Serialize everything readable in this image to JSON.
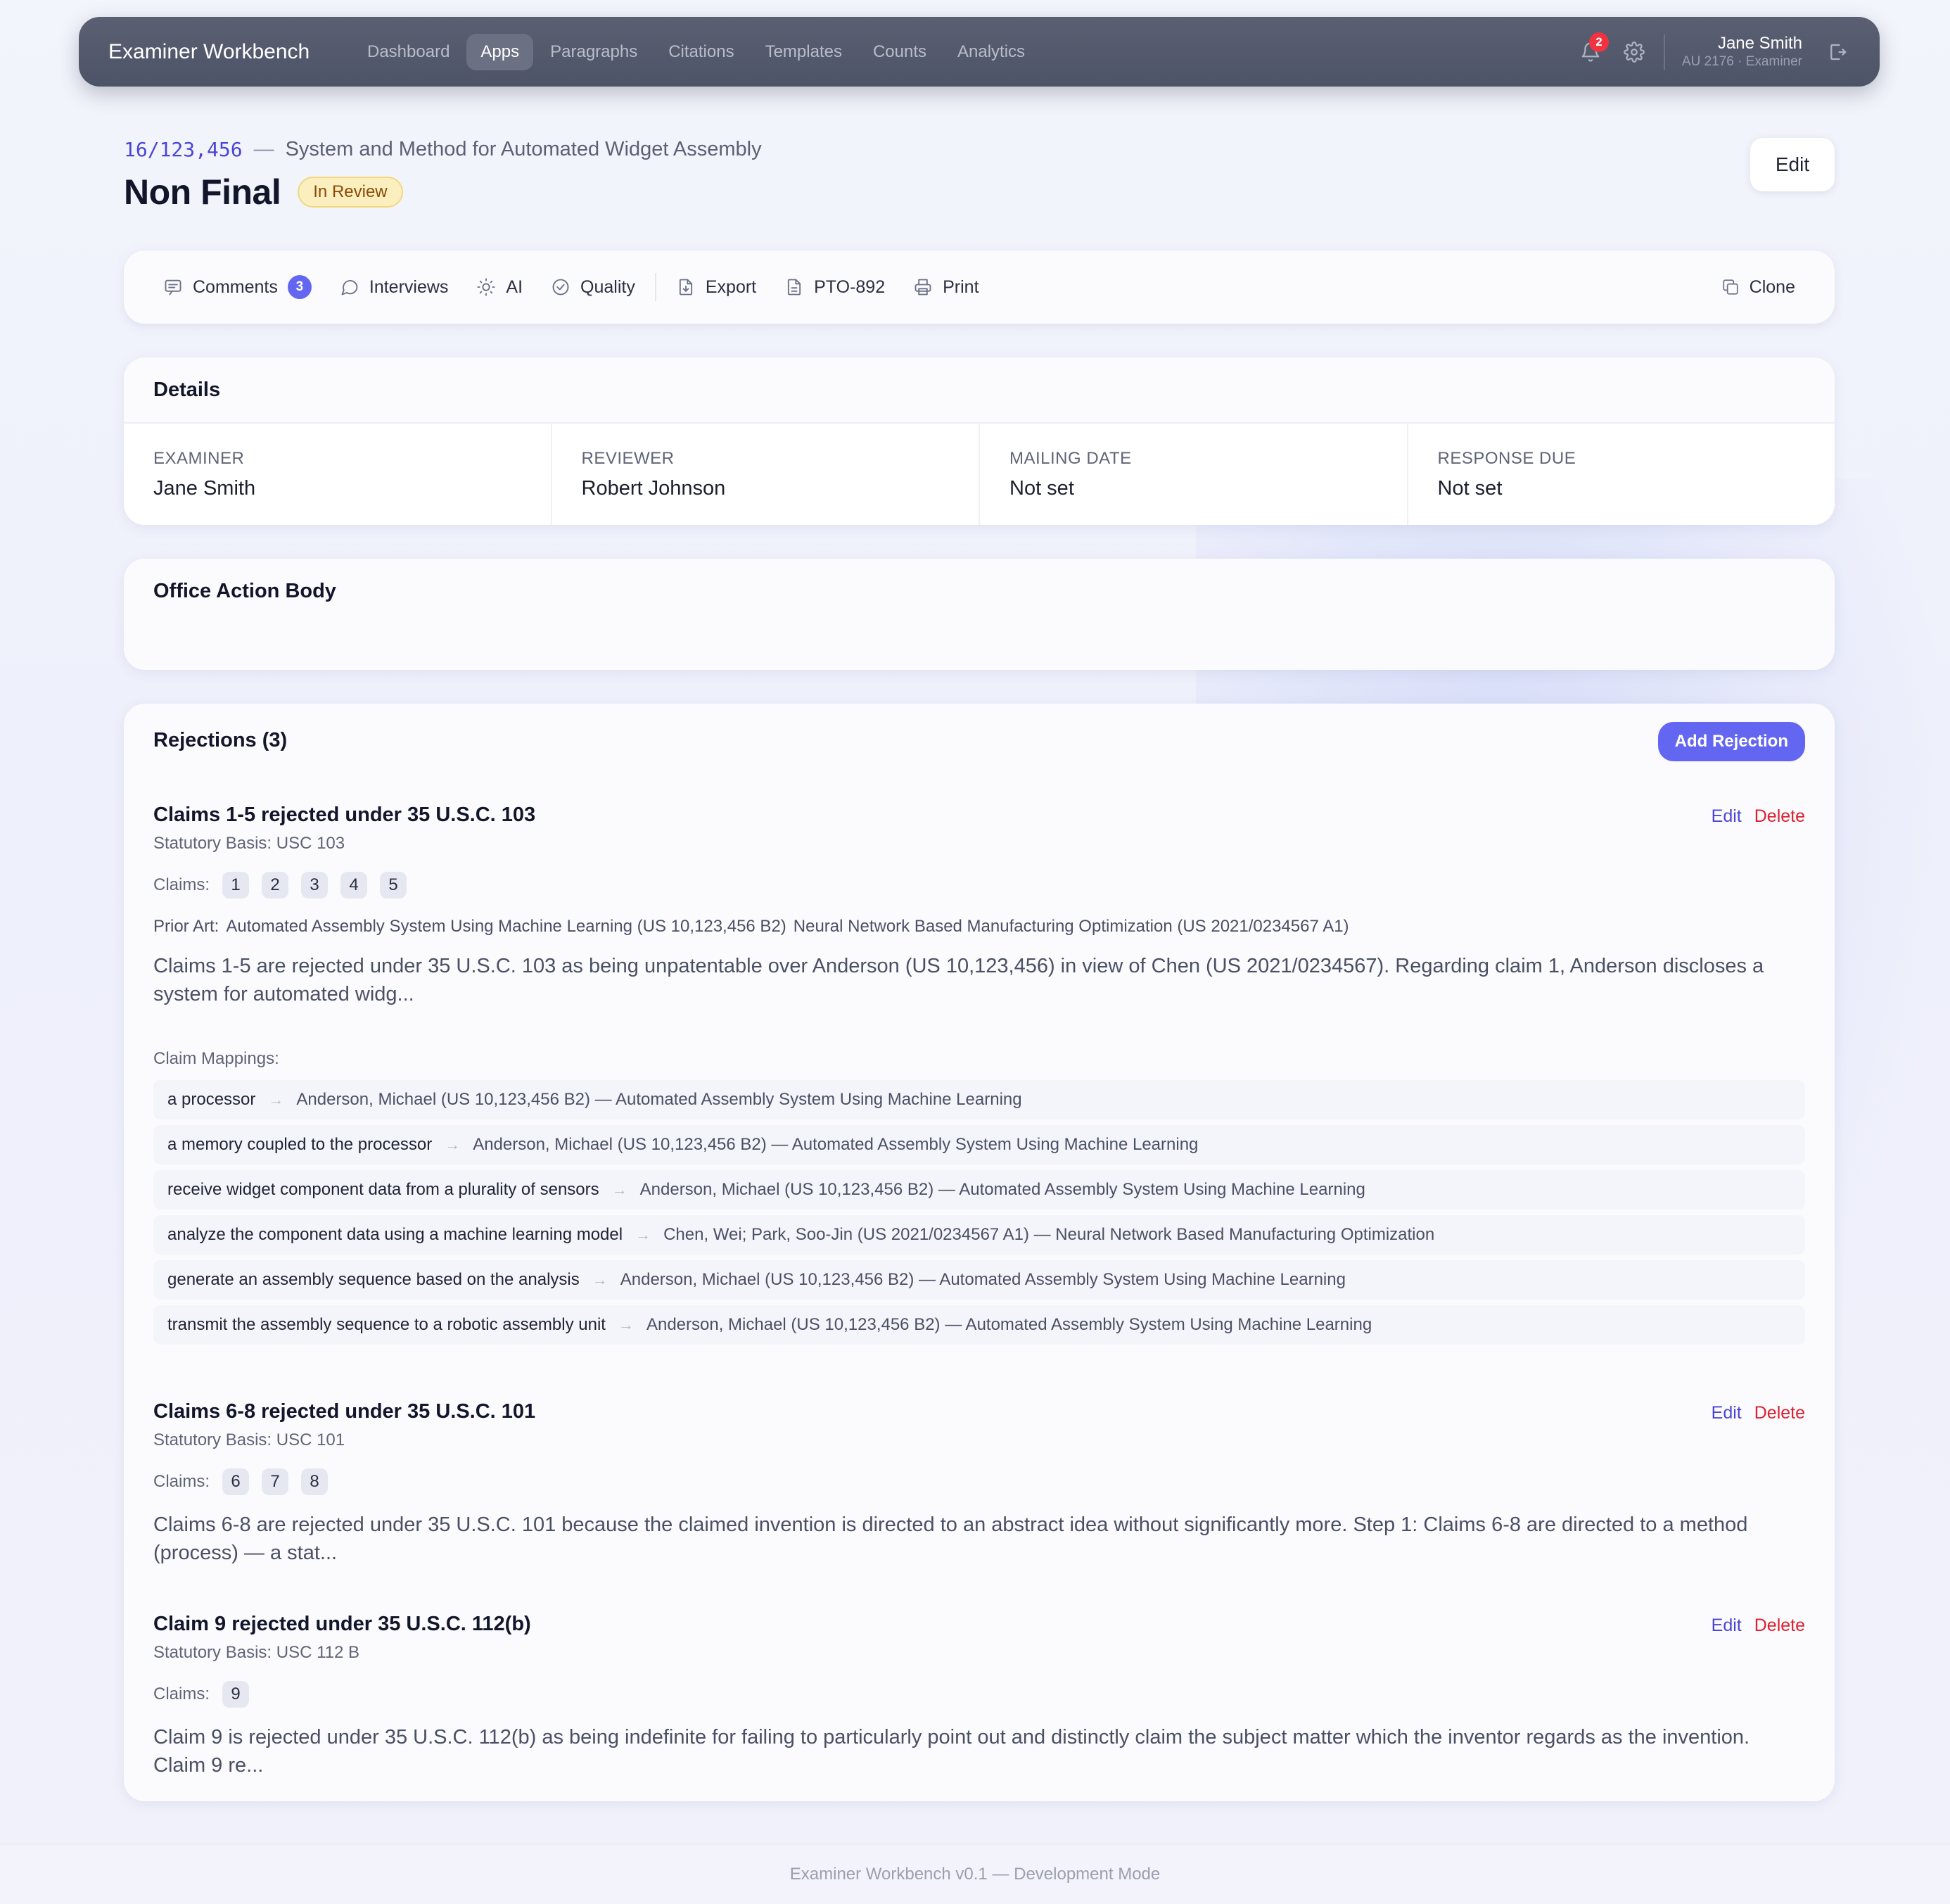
{
  "nav": {
    "brand": "Examiner Workbench",
    "links": [
      "Dashboard",
      "Apps",
      "Paragraphs",
      "Citations",
      "Templates",
      "Counts",
      "Analytics"
    ],
    "active": "Apps",
    "notification_count": "2",
    "user_name": "Jane Smith",
    "user_role": "AU 2176 · Examiner"
  },
  "header": {
    "app_number": "16/123,456",
    "dash": "—",
    "app_title": "System and Method for Automated Widget Assembly",
    "page_title": "Non Final",
    "status": "In Review",
    "edit_label": "Edit"
  },
  "toolbar": {
    "comments": "Comments",
    "comments_count": "3",
    "interviews": "Interviews",
    "ai": "AI",
    "quality": "Quality",
    "export": "Export",
    "pto892": "PTO-892",
    "print": "Print",
    "clone": "Clone"
  },
  "details": {
    "title": "Details",
    "fields": [
      {
        "label": "EXAMINER",
        "value": "Jane Smith"
      },
      {
        "label": "REVIEWER",
        "value": "Robert Johnson"
      },
      {
        "label": "MAILING DATE",
        "value": "Not set"
      },
      {
        "label": "RESPONSE DUE",
        "value": "Not set"
      }
    ]
  },
  "body_section": {
    "title": "Office Action Body"
  },
  "rejections": {
    "title": "Rejections (3)",
    "add_label": "Add Rejection",
    "edit_label": "Edit",
    "delete_label": "Delete",
    "claims_label": "Claims:",
    "mappings_label": "Claim Mappings:",
    "items": [
      {
        "title": "Claims 1-5 rejected under 35 U.S.C. 103",
        "basis": "Statutory Basis: USC 103",
        "claims": [
          "1",
          "2",
          "3",
          "4",
          "5"
        ],
        "prior_art_label": "Prior Art:",
        "prior_art": [
          "Automated Assembly System Using Machine Learning (US 10,123,456 B2)",
          "Neural Network Based Manufacturing Optimization (US 2021/0234567 A1)"
        ],
        "text": "Claims 1-5 are rejected under 35 U.S.C. 103 as being unpatentable over Anderson (US 10,123,456) in view of Chen (US 2021/0234567). Regarding claim 1, Anderson discloses a system for automated widg...",
        "mappings": [
          {
            "claim": "a processor",
            "ref": "Anderson, Michael (US 10,123,456 B2) — Automated Assembly System Using Machine Learning"
          },
          {
            "claim": "a memory coupled to the processor",
            "ref": "Anderson, Michael (US 10,123,456 B2) — Automated Assembly System Using Machine Learning"
          },
          {
            "claim": "receive widget component data from a plurality of sensors",
            "ref": "Anderson, Michael (US 10,123,456 B2) — Automated Assembly System Using Machine Learning"
          },
          {
            "claim": "analyze the component data using a machine learning model",
            "ref": "Chen, Wei; Park, Soo-Jin (US 2021/0234567 A1) — Neural Network Based Manufacturing Optimization"
          },
          {
            "claim": "generate an assembly sequence based on the analysis",
            "ref": "Anderson, Michael (US 10,123,456 B2) — Automated Assembly System Using Machine Learning"
          },
          {
            "claim": "transmit the assembly sequence to a robotic assembly unit",
            "ref": "Anderson, Michael (US 10,123,456 B2) — Automated Assembly System Using Machine Learning"
          }
        ]
      },
      {
        "title": "Claims 6-8 rejected under 35 U.S.C. 101",
        "basis": "Statutory Basis: USC 101",
        "claims": [
          "6",
          "7",
          "8"
        ],
        "text": "Claims 6-8 are rejected under 35 U.S.C. 101 because the claimed invention is directed to an abstract idea without significantly more. Step 1: Claims 6-8 are directed to a method (process) — a stat..."
      },
      {
        "title": "Claim 9 rejected under 35 U.S.C. 112(b)",
        "basis": "Statutory Basis: USC 112 B",
        "claims": [
          "9"
        ],
        "text": "Claim 9 is rejected under 35 U.S.C. 112(b) as being indefinite for failing to particularly point out and distinctly claim the subject matter which the inventor regards as the invention. Claim 9 re..."
      }
    ]
  },
  "footer": "Examiner Workbench v0.1 — Development Mode",
  "colors": {
    "accent": "#6366f1",
    "link": "#4b45d6",
    "danger": "#dc1f2e",
    "nav_bg": "#545a6c",
    "status_bg": "#fcefbf"
  }
}
